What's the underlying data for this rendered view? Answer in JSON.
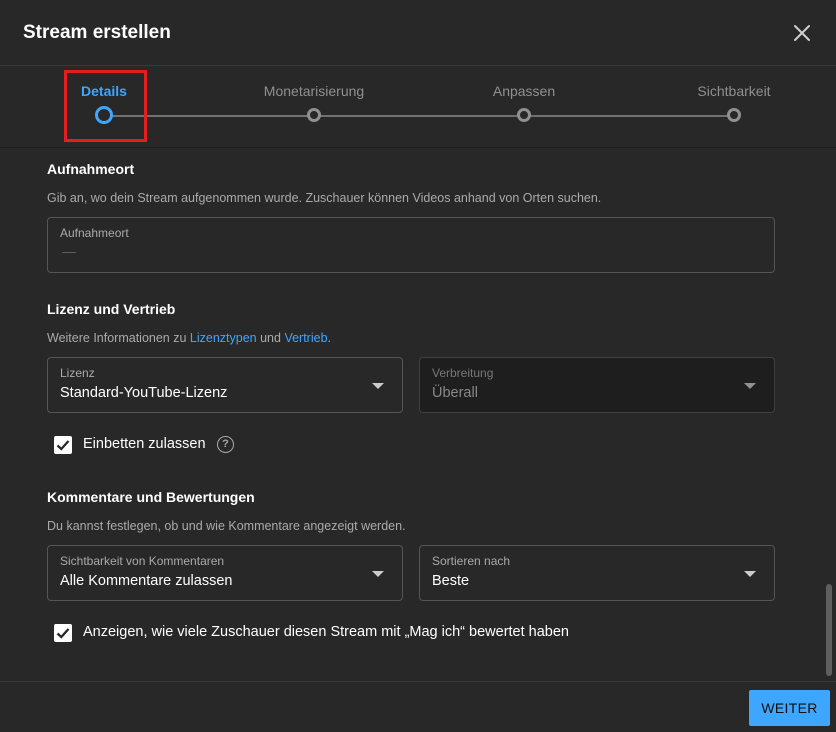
{
  "dialog": {
    "title": "Stream erstellen"
  },
  "stepper": {
    "steps": [
      {
        "label": "Details",
        "active": true
      },
      {
        "label": "Monetarisierung",
        "active": false
      },
      {
        "label": "Anpassen",
        "active": false
      },
      {
        "label": "Sichtbarkeit",
        "active": false
      }
    ],
    "highlight_color": "#e41e1e"
  },
  "location": {
    "title": "Aufnahmeort",
    "description": "Gib an, wo dein Stream aufgenommen wurde. Zuschauer können Videos anhand von Orten suchen.",
    "field_label": "Aufnahmeort",
    "field_value": "—"
  },
  "license": {
    "title": "Lizenz und Vertrieb",
    "desc_prefix": "Weitere Informationen zu ",
    "link_license_types": "Lizenztypen",
    "desc_and": " und ",
    "link_distribution": "Vertrieb",
    "desc_suffix": ".",
    "license_field": {
      "label": "Lizenz",
      "value": "Standard-YouTube-Lizenz"
    },
    "distribution_field": {
      "label": "Verbreitung",
      "value": "Überall"
    },
    "embed_checkbox": {
      "label": "Einbetten zulassen",
      "checked": true
    }
  },
  "comments": {
    "title": "Kommentare und Bewertungen",
    "description": "Du kannst festlegen, ob und wie Kommentare angezeigt werden.",
    "visibility_field": {
      "label": "Sichtbarkeit von Kommentaren",
      "value": "Alle Kommentare zulassen"
    },
    "sort_field": {
      "label": "Sortieren nach",
      "value": "Beste"
    },
    "likes_checkbox": {
      "label": "Anzeigen, wie viele Zuschauer diesen Stream mit „Mag ich“ bewertet haben",
      "checked": true
    }
  },
  "footer": {
    "next_label": "WEITER"
  },
  "colors": {
    "accent": "#3ea6ff",
    "background": "#282828",
    "text": "#ffffff",
    "muted_text": "#aaaaaa"
  },
  "icons": {
    "close": "close-icon",
    "dropdown": "caret-down-icon",
    "help": "help-circle-icon",
    "check": "checkmark-icon"
  }
}
